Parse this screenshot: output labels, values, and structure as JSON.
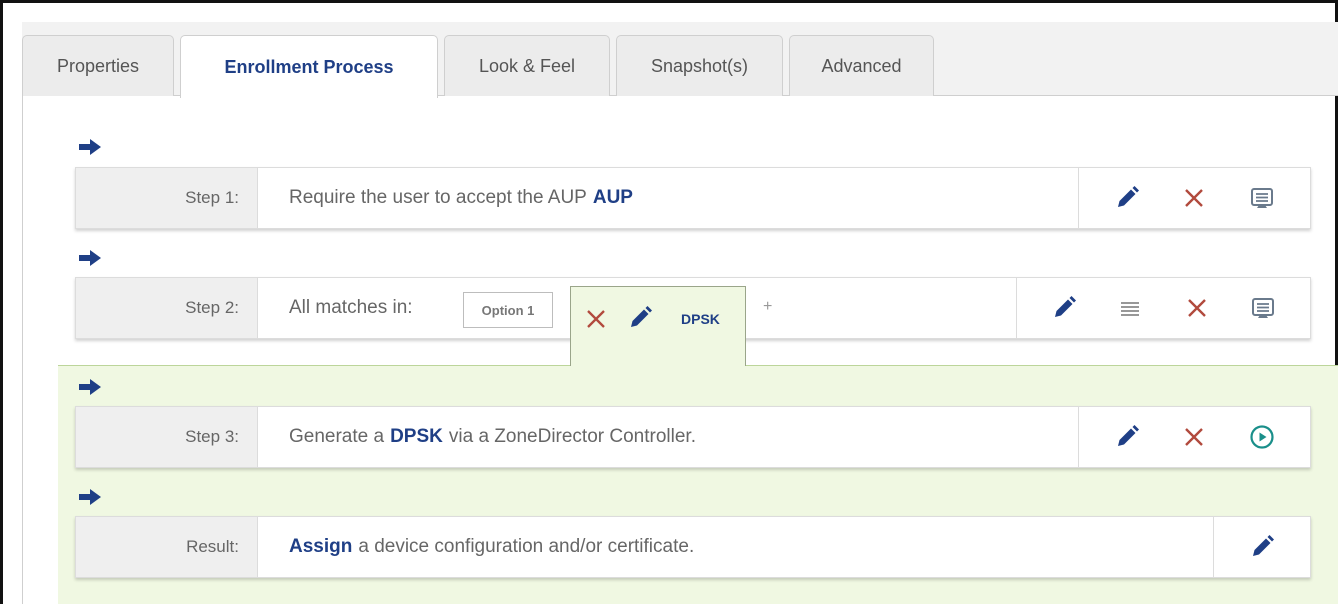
{
  "tabs": [
    {
      "label": "Properties",
      "active": false
    },
    {
      "label": "Enrollment Process",
      "active": true
    },
    {
      "label": "Look & Feel",
      "active": false
    },
    {
      "label": "Snapshot(s)",
      "active": false
    },
    {
      "label": "Advanced",
      "active": false
    }
  ],
  "steps": {
    "step1": {
      "label": "Step 1:",
      "text_before": "Require the user to accept the AUP",
      "highlight": "AUP",
      "actions": [
        "edit-icon",
        "delete-icon",
        "preview-icon"
      ]
    },
    "step2": {
      "label": "Step 2:",
      "text_before": "All matches in:",
      "option_label": "Option 1",
      "tab_label": "DPSK",
      "add_label": "+",
      "actions": [
        "edit-icon",
        "reorder-icon",
        "delete-icon",
        "preview-icon"
      ]
    },
    "step3": {
      "label": "Step 3:",
      "text_before": "Generate a",
      "highlight": "DPSK",
      "text_after": "via a ZoneDirector Controller.",
      "actions": [
        "edit-icon",
        "delete-icon",
        "play-icon"
      ]
    },
    "result": {
      "label": "Result:",
      "lead": "Assign",
      "text_after": "a device configuration and/or certificate.",
      "actions": [
        "edit-icon"
      ]
    }
  },
  "colors": {
    "accent": "#1f3f86",
    "delete": "#b24a3d",
    "preview": "#6a7a8c",
    "play": "#1a8f8a",
    "green_zone": "#f0f8e2"
  }
}
